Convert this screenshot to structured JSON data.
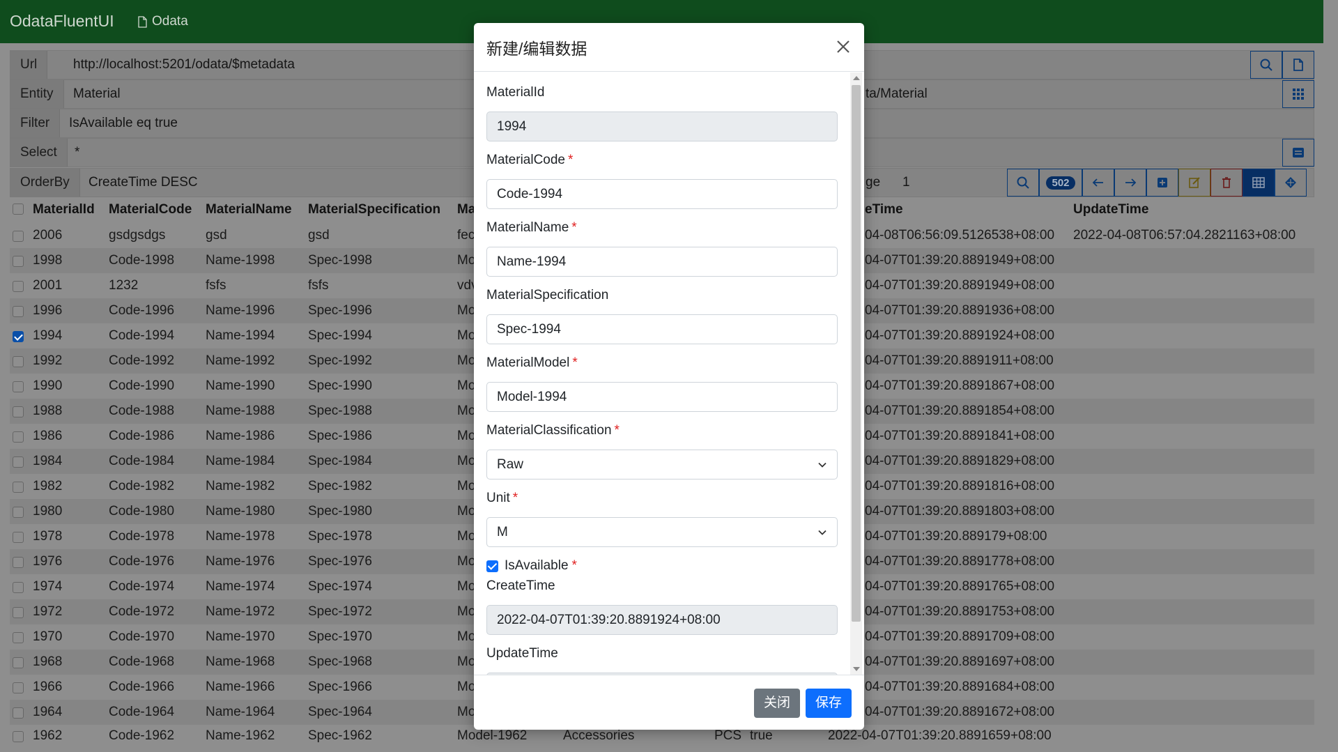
{
  "app": {
    "title": "OdataFluentUI",
    "nav_link": "Odata"
  },
  "query": {
    "url_label": "Url",
    "url_value": "http://localhost:5201/odata/$metadata",
    "entity_label": "Entity",
    "entity_value": "Material",
    "entity_path": "ta/Material",
    "filter_label": "Filter",
    "filter_value": "IsAvailable eq true",
    "select_label": "Select",
    "select_value": "*",
    "orderby_label": "OrderBy",
    "orderby_value": "CreateTime DESC",
    "page_label": "ge",
    "page_value": "1",
    "count_badge": "502"
  },
  "table": {
    "headers": [
      "MaterialId",
      "MaterialCode",
      "MaterialName",
      "MaterialSpecification",
      "Ma",
      "eTime",
      "UpdateTime"
    ],
    "rows": [
      {
        "id": "2006",
        "code": "gsdgsdgs",
        "name": "gsd",
        "spec": "gsd",
        "model": "fec",
        "create": "04-08T06:56:09.5126538+08:00",
        "update": "2022-04-08T06:57:04.2821163+08:00",
        "checked": false
      },
      {
        "id": "1998",
        "code": "Code-1998",
        "name": "Name-1998",
        "spec": "Spec-1998",
        "model": "Mo",
        "create": "04-07T01:39:20.8891949+08:00",
        "update": "",
        "checked": false
      },
      {
        "id": "2001",
        "code": "1232",
        "name": "fsfs",
        "spec": "fsfs",
        "model": "vdv",
        "create": "04-07T01:39:20.8891949+08:00",
        "update": "",
        "checked": false
      },
      {
        "id": "1996",
        "code": "Code-1996",
        "name": "Name-1996",
        "spec": "Spec-1996",
        "model": "Mo",
        "create": "04-07T01:39:20.8891936+08:00",
        "update": "",
        "checked": false
      },
      {
        "id": "1994",
        "code": "Code-1994",
        "name": "Name-1994",
        "spec": "Spec-1994",
        "model": "Mo",
        "create": "04-07T01:39:20.8891924+08:00",
        "update": "",
        "checked": true
      },
      {
        "id": "1992",
        "code": "Code-1992",
        "name": "Name-1992",
        "spec": "Spec-1992",
        "model": "Mo",
        "create": "04-07T01:39:20.8891911+08:00",
        "update": "",
        "checked": false
      },
      {
        "id": "1990",
        "code": "Code-1990",
        "name": "Name-1990",
        "spec": "Spec-1990",
        "model": "Mo",
        "create": "04-07T01:39:20.8891867+08:00",
        "update": "",
        "checked": false
      },
      {
        "id": "1988",
        "code": "Code-1988",
        "name": "Name-1988",
        "spec": "Spec-1988",
        "model": "Mo",
        "create": "04-07T01:39:20.8891854+08:00",
        "update": "",
        "checked": false
      },
      {
        "id": "1986",
        "code": "Code-1986",
        "name": "Name-1986",
        "spec": "Spec-1986",
        "model": "Mo",
        "create": "04-07T01:39:20.8891841+08:00",
        "update": "",
        "checked": false
      },
      {
        "id": "1984",
        "code": "Code-1984",
        "name": "Name-1984",
        "spec": "Spec-1984",
        "model": "Mo",
        "create": "04-07T01:39:20.8891829+08:00",
        "update": "",
        "checked": false
      },
      {
        "id": "1982",
        "code": "Code-1982",
        "name": "Name-1982",
        "spec": "Spec-1982",
        "model": "Mo",
        "create": "04-07T01:39:20.8891816+08:00",
        "update": "",
        "checked": false
      },
      {
        "id": "1980",
        "code": "Code-1980",
        "name": "Name-1980",
        "spec": "Spec-1980",
        "model": "Mo",
        "create": "04-07T01:39:20.8891803+08:00",
        "update": "",
        "checked": false
      },
      {
        "id": "1978",
        "code": "Code-1978",
        "name": "Name-1978",
        "spec": "Spec-1978",
        "model": "Mo",
        "create": "04-07T01:39:20.889179+08:00",
        "update": "",
        "checked": false
      },
      {
        "id": "1976",
        "code": "Code-1976",
        "name": "Name-1976",
        "spec": "Spec-1976",
        "model": "Mo",
        "create": "04-07T01:39:20.8891778+08:00",
        "update": "",
        "checked": false
      },
      {
        "id": "1974",
        "code": "Code-1974",
        "name": "Name-1974",
        "spec": "Spec-1974",
        "model": "Mo",
        "create": "04-07T01:39:20.8891765+08:00",
        "update": "",
        "checked": false
      },
      {
        "id": "1972",
        "code": "Code-1972",
        "name": "Name-1972",
        "spec": "Spec-1972",
        "model": "Mo",
        "create": "04-07T01:39:20.8891753+08:00",
        "update": "",
        "checked": false
      },
      {
        "id": "1970",
        "code": "Code-1970",
        "name": "Name-1970",
        "spec": "Spec-1970",
        "model": "Mo",
        "create": "04-07T01:39:20.8891709+08:00",
        "update": "",
        "checked": false
      },
      {
        "id": "1968",
        "code": "Code-1968",
        "name": "Name-1968",
        "spec": "Spec-1968",
        "model": "Mo",
        "create": "04-07T01:39:20.8891697+08:00",
        "update": "",
        "checked": false
      },
      {
        "id": "1966",
        "code": "Code-1966",
        "name": "Name-1966",
        "spec": "Spec-1966",
        "model": "Mo",
        "create": "04-07T01:39:20.8891684+08:00",
        "update": "",
        "checked": false
      },
      {
        "id": "1964",
        "code": "Code-1964",
        "name": "Name-1964",
        "spec": "Spec-1964",
        "model": "Mo",
        "create": "04-07T01:39:20.8891672+08:00",
        "update": "",
        "checked": false
      }
    ],
    "last_row": {
      "id": "1962",
      "code": "Code-1962",
      "name": "Name-1962",
      "spec": "Spec-1962",
      "model": "Model-1962",
      "classification": "Accessories",
      "unit": "PCS",
      "available": "true",
      "create": "2022-04-07T01:39:20.8891659+08:00"
    }
  },
  "modal": {
    "title": "新建/编辑数据",
    "fields": {
      "material_id": {
        "label": "MaterialId",
        "value": "1994"
      },
      "material_code": {
        "label": "MaterialCode",
        "value": "Code-1994"
      },
      "material_name": {
        "label": "MaterialName",
        "value": "Name-1994"
      },
      "material_spec": {
        "label": "MaterialSpecification",
        "value": "Spec-1994"
      },
      "material_model": {
        "label": "MaterialModel",
        "value": "Model-1994"
      },
      "material_class": {
        "label": "MaterialClassification",
        "value": "Raw"
      },
      "unit": {
        "label": "Unit",
        "value": "M"
      },
      "is_available": {
        "label": "IsAvailable",
        "checked": true
      },
      "create_time": {
        "label": "CreateTime",
        "value": "2022-04-07T01:39:20.8891924+08:00"
      },
      "update_time": {
        "label": "UpdateTime",
        "value": ""
      }
    },
    "required_mark": "*",
    "close_label": "关闭",
    "save_label": "保存"
  },
  "colors": {
    "topbar": "#0f4c1d",
    "primary": "#0d6efd",
    "secondary": "#6c757d",
    "required": "#e02020"
  }
}
